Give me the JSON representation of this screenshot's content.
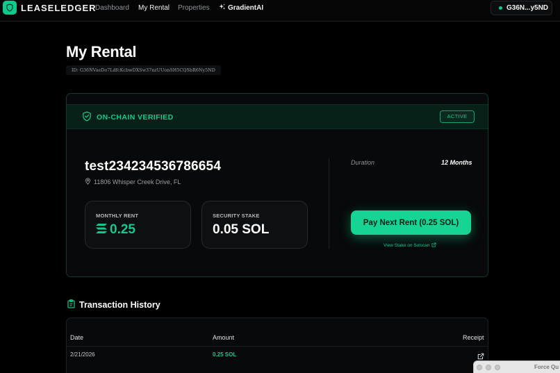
{
  "nav": {
    "brand": "LEASELEDGER",
    "links": [
      {
        "label": "Dashboard",
        "active": false
      },
      {
        "label": "My Rental",
        "active": true
      },
      {
        "label": "Properties",
        "active": false
      }
    ],
    "ai_label": "GradientAI",
    "wallet": "G36N...y5ND"
  },
  "page": {
    "title": "My Rental",
    "id_label": "ID: G36NVaeDo7LdfcKcbwDXSw37nzUUonSH5CQSbR6Ny5ND"
  },
  "card": {
    "verified_label": "ON-CHAIN VERIFIED",
    "status_badge": "ACTIVE",
    "property_name": "test234234536786654",
    "address": "11806 Whisper Creek Drive, FL",
    "monthly_rent": {
      "label": "MONTHLY RENT",
      "value": "0.25"
    },
    "security_stake": {
      "label": "SECURITY STAKE",
      "value": "0.05 SOL"
    },
    "duration": {
      "label": "Duration",
      "value": "12 Months"
    },
    "pay_button": "Pay Next Rent (0.25 SOL)",
    "solscan_link": "View Stake on Solscan"
  },
  "history": {
    "title": "Transaction History",
    "columns": {
      "date": "Date",
      "amount": "Amount",
      "receipt": "Receipt"
    },
    "rows": [
      {
        "date": "2/21/2026",
        "amount": "0.25 SOL"
      }
    ]
  },
  "force_quit": {
    "title": "Force Qu"
  },
  "colors": {
    "accent": "#14c98f",
    "background": "#000000",
    "card": "#07090a",
    "verified_bar": "#072119"
  }
}
